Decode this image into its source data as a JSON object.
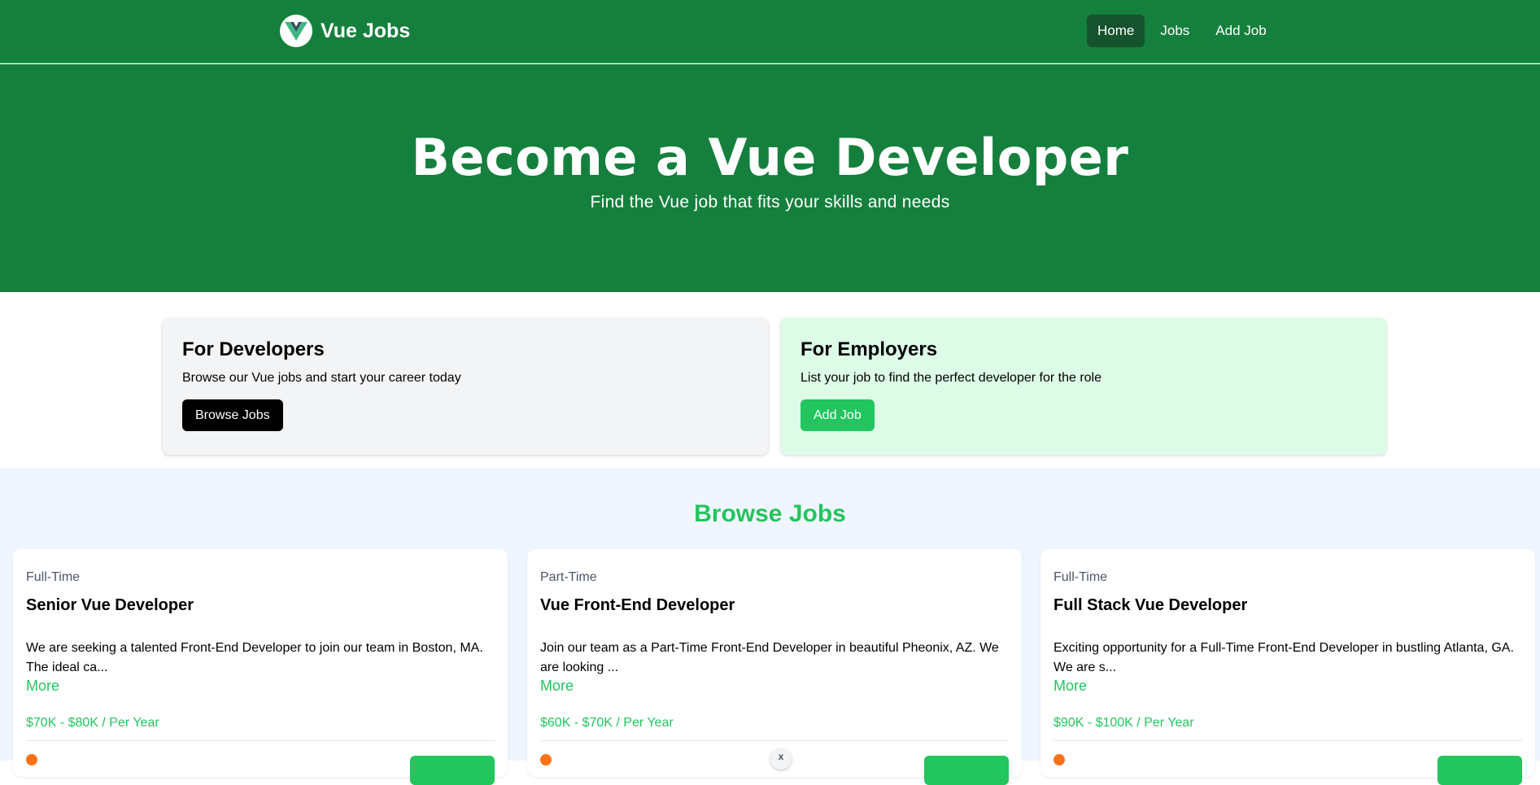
{
  "brand": {
    "name": "Vue Jobs",
    "logo_icon": "vue-logo-icon"
  },
  "nav": {
    "items": [
      {
        "label": "Home",
        "active": true
      },
      {
        "label": "Jobs",
        "active": false
      },
      {
        "label": "Add Job",
        "active": false
      }
    ]
  },
  "hero": {
    "title": "Become a Vue Developer",
    "subtitle": "Find the Vue job that fits your skills and needs"
  },
  "cards": {
    "developers": {
      "title": "For Developers",
      "text": "Browse our Vue jobs and start your career today",
      "button": "Browse Jobs"
    },
    "employers": {
      "title": "For Employers",
      "text": "List your job to find the perfect developer for the role",
      "button": "Add Job"
    }
  },
  "browse": {
    "title": "Browse Jobs",
    "jobs": [
      {
        "type": "Full-Time",
        "title": "Senior Vue Developer",
        "description": "We are seeking a talented Front-End Developer to join our team in Boston, MA. The ideal ca...",
        "more": "More",
        "salary": "$70K - $80K / Per Year"
      },
      {
        "type": "Part-Time",
        "title": "Vue Front-End Developer",
        "description": "Join our team as a Part-Time Front-End Developer in beautiful Pheonix, AZ. We are looking ...",
        "more": "More",
        "salary": "$60K - $70K / Per Year"
      },
      {
        "type": "Full-Time",
        "title": "Full Stack Vue Developer",
        "description": "Exciting opportunity for a Full-Time Front-End Developer in bustling Atlanta, GA. We are s...",
        "more": "More",
        "salary": "$90K - $100K / Per Year"
      }
    ]
  },
  "colors": {
    "nav_green": "#15803d",
    "accent_green": "#22c55e",
    "active_nav": "#14532d",
    "dev_card_bg": "#f3f4f6",
    "emp_card_bg": "#dcfce7",
    "browse_bg": "#eff6ff"
  },
  "overlay": {
    "close_glyph": "x"
  }
}
